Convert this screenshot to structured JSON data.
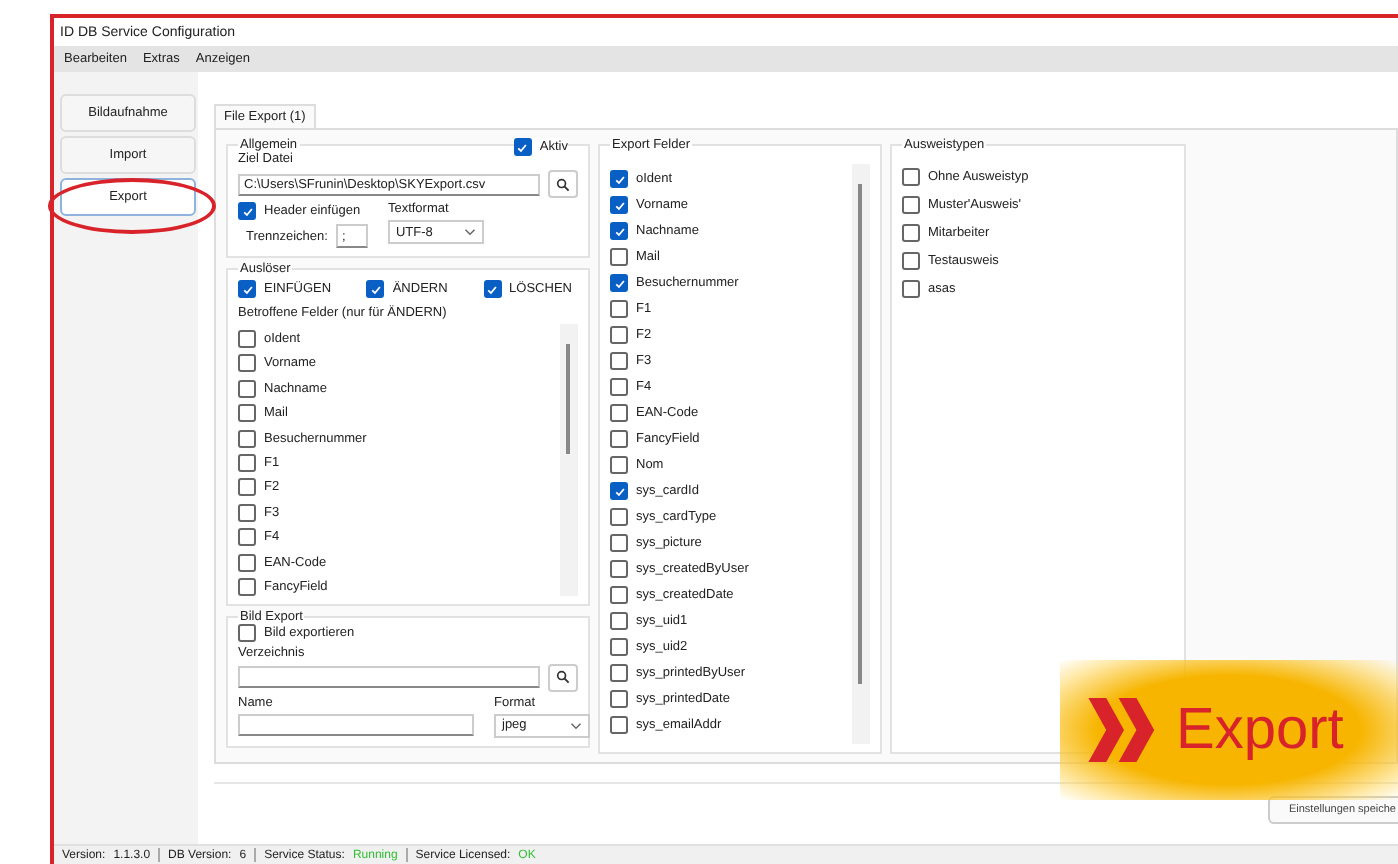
{
  "window": {
    "title": "ID DB Service Configuration"
  },
  "menu": [
    "Bearbeiten",
    "Extras",
    "Anzeigen"
  ],
  "sidebar": {
    "items": [
      {
        "label": "Bildaufnahme",
        "selected": false
      },
      {
        "label": "Import",
        "selected": false
      },
      {
        "label": "Export",
        "selected": true
      }
    ]
  },
  "tabs": [
    {
      "label": "File Export (1)",
      "selected": true
    }
  ],
  "allgemein": {
    "heading": "Allgemein",
    "aktiv": {
      "label": "Aktiv",
      "checked": true
    },
    "ziel_label": "Ziel Datei",
    "ziel_value": "C:\\Users\\SFrunin\\Desktop\\SKYExport.csv",
    "header": {
      "label": "Header einfügen",
      "checked": true
    },
    "textformat_label": "Textformat",
    "textformat_value": "UTF-8",
    "trenn_label": "Trennzeichen:",
    "trenn_value": ";"
  },
  "ausloeser": {
    "heading": "Auslöser",
    "triggers": [
      {
        "label": "EINFÜGEN",
        "checked": true
      },
      {
        "label": "ÄNDERN",
        "checked": true
      },
      {
        "label": "LÖSCHEN",
        "checked": true
      }
    ],
    "affected_label": "Betroffene Felder (nur für ÄNDERN)",
    "fields": [
      {
        "label": "oIdent",
        "checked": false
      },
      {
        "label": "Vorname",
        "checked": false
      },
      {
        "label": "Nachname",
        "checked": false
      },
      {
        "label": "Mail",
        "checked": false
      },
      {
        "label": "Besuchernummer",
        "checked": false
      },
      {
        "label": "F1",
        "checked": false
      },
      {
        "label": "F2",
        "checked": false
      },
      {
        "label": "F3",
        "checked": false
      },
      {
        "label": "F4",
        "checked": false
      },
      {
        "label": "EAN-Code",
        "checked": false
      },
      {
        "label": "FancyField",
        "checked": false
      }
    ]
  },
  "bild_export": {
    "heading": "Bild Export",
    "export": {
      "label": "Bild exportieren",
      "checked": false
    },
    "verzeichnis_label": "Verzeichnis",
    "name_label": "Name",
    "format_label": "Format",
    "format_value": "jpeg"
  },
  "export_felder": {
    "heading": "Export Felder",
    "fields": [
      {
        "label": "oIdent",
        "checked": true
      },
      {
        "label": "Vorname",
        "checked": true
      },
      {
        "label": "Nachname",
        "checked": true
      },
      {
        "label": "Mail",
        "checked": false
      },
      {
        "label": "Besuchernummer",
        "checked": true
      },
      {
        "label": "F1",
        "checked": false
      },
      {
        "label": "F2",
        "checked": false
      },
      {
        "label": "F3",
        "checked": false
      },
      {
        "label": "F4",
        "checked": false
      },
      {
        "label": "EAN-Code",
        "checked": false
      },
      {
        "label": "FancyField",
        "checked": false
      },
      {
        "label": "Nom",
        "checked": false
      },
      {
        "label": "sys_cardId",
        "checked": true
      },
      {
        "label": "sys_cardType",
        "checked": false
      },
      {
        "label": "sys_picture",
        "checked": false
      },
      {
        "label": "sys_createdByUser",
        "checked": false
      },
      {
        "label": "sys_createdDate",
        "checked": false
      },
      {
        "label": "sys_uid1",
        "checked": false
      },
      {
        "label": "sys_uid2",
        "checked": false
      },
      {
        "label": "sys_printedByUser",
        "checked": false
      },
      {
        "label": "sys_printedDate",
        "checked": false
      },
      {
        "label": "sys_emailAddr",
        "checked": false
      }
    ]
  },
  "ausweistypen": {
    "heading": "Ausweistypen",
    "items": [
      {
        "label": "Ohne Ausweistyp",
        "checked": false
      },
      {
        "label": "Muster'Ausweis'",
        "checked": false
      },
      {
        "label": "Mitarbeiter",
        "checked": false
      },
      {
        "label": "Testausweis",
        "checked": false
      },
      {
        "label": "asas",
        "checked": false
      }
    ]
  },
  "save_button": "Einstellungen speiche",
  "status_bar": [
    {
      "label": "Version:",
      "value": "1.1.3.0"
    },
    {
      "label": "DB Version:",
      "value": "6"
    },
    {
      "label": "Service Status:",
      "value": "Running",
      "color": "#2fbf2f"
    },
    {
      "label": "Service Licensed:",
      "value": "OK",
      "color": "#2fbf2f"
    }
  ],
  "callout": {
    "label": "Export"
  }
}
